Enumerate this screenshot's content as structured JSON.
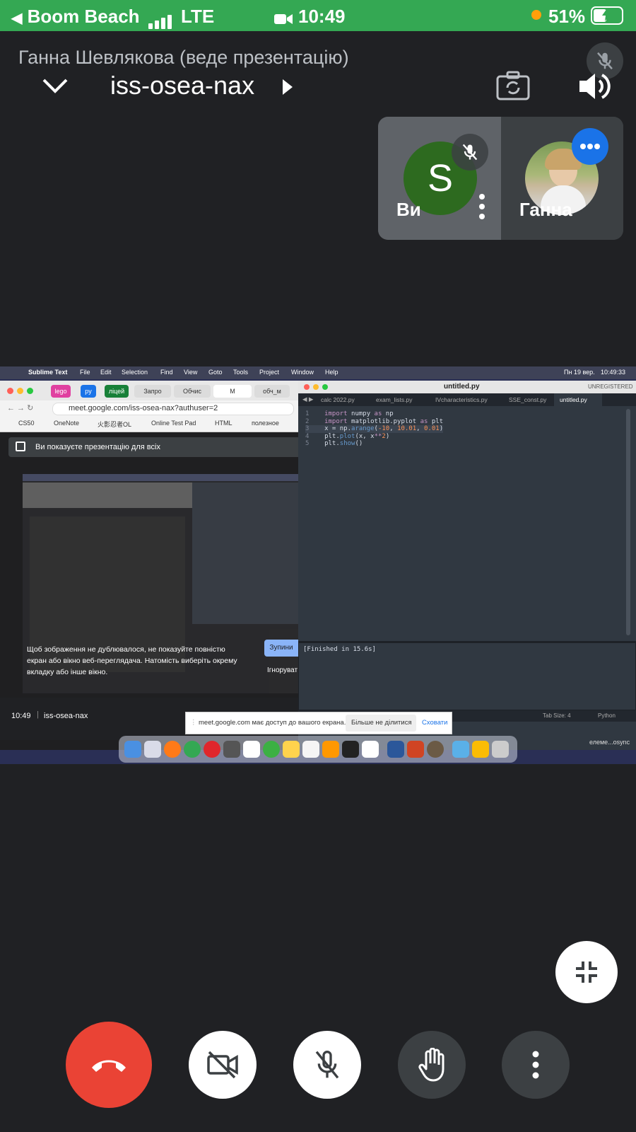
{
  "status_bar": {
    "back_app": "Boom Beach",
    "network": "LTE",
    "time": "10:49",
    "battery_percent": "51%",
    "battery_level": 0.51
  },
  "header": {
    "presenter_label": "Ганна Шевлякова (веде презентацію)",
    "meeting_code": "iss-osea-nax"
  },
  "participants": [
    {
      "initial": "S",
      "name": "Ви",
      "avatar_color": "#2d6a1f"
    },
    {
      "name": "Ганна"
    }
  ],
  "shared_screen": {
    "menubar": {
      "app": "Sublime Text",
      "items": [
        "File",
        "Edit",
        "Selection",
        "Find",
        "View",
        "Goto",
        "Tools",
        "Project",
        "Window",
        "Help"
      ],
      "date": "Пн 19 вер.",
      "clock": "10:49:33"
    },
    "browser": {
      "tabs": [
        "lego",
        "py",
        "ліцей",
        "Запро",
        "Обчис",
        "М",
        "обч_м"
      ],
      "url": "meet.google.com/iss-osea-nax?authuser=2",
      "bookmarks": [
        "CS50",
        "OneNote",
        "火影忍者OL",
        "Online Test Pad",
        "HTML",
        "полезное"
      ],
      "banner": "Ви показуєте презентацію для всіх",
      "warning": "Щоб зображення не дублювалося, не показуйте повністю екран або вікно веб-переглядача. Натомість виберіть окрему вкладку або інше вікно.",
      "stop_button": "Зупини",
      "ignore_button": "Ігноруват",
      "footer_time": "10:49",
      "footer_code": "iss-osea-nax"
    },
    "editor": {
      "title": "untitled.py",
      "license": "UNREGISTERED",
      "tabs": [
        "calc 2022.py",
        "exam_lists.py",
        "IVcharacteristics.py",
        "SSE_const.py",
        "untitled.py"
      ],
      "code": {
        "l1": {
          "a": "import",
          "b": " numpy ",
          "c": "as",
          "d": " np"
        },
        "l2": {
          "a": "import",
          "b": " matplotlib.pyplot ",
          "c": "as",
          "d": " plt"
        },
        "l3": {
          "a": "x = np.",
          "b": "arange",
          "c": "(",
          "d": "-10",
          "e": ", ",
          "f": "10.01",
          "g": ", ",
          "h": "0.01",
          "i": ")"
        },
        "l4": {
          "a": "plt.",
          "b": "plot",
          "c": "(x, x",
          "d": "**",
          "e": "2",
          "f": ")"
        },
        "l5": {
          "a": "plt.",
          "b": "show",
          "c": "()"
        }
      },
      "console": "[Finished in 15.6s]",
      "status_tab": "Tab Size: 4",
      "status_lang": "Python",
      "dock_caption": "елеме...osync"
    },
    "share_bar": {
      "text": "meet.google.com має доступ до вашого екрана.",
      "stop": "Більше не ділитися",
      "hide": "Сховати"
    }
  }
}
